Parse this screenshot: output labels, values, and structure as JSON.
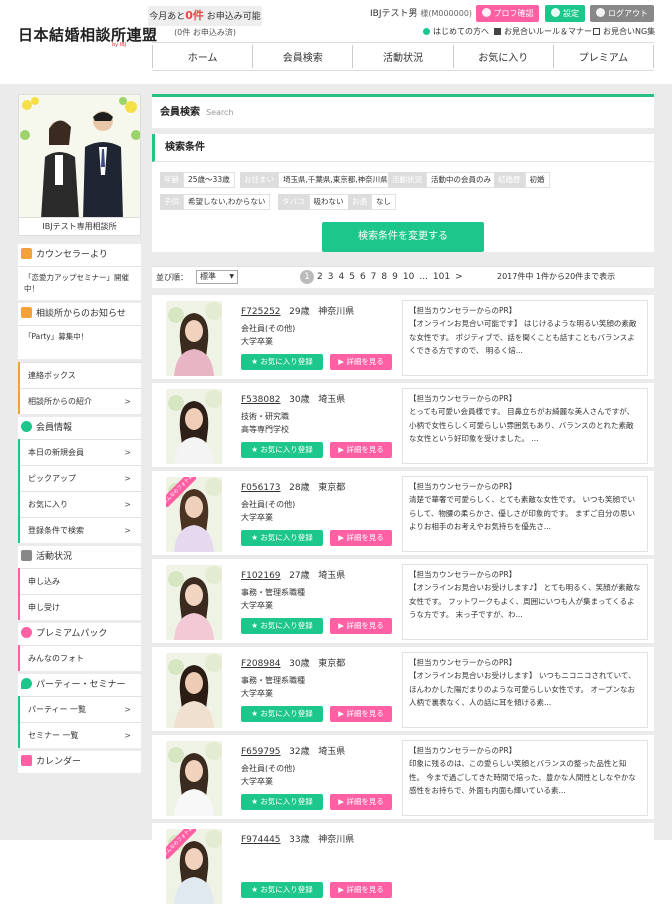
{
  "header": {
    "logo": "日本結婚相談所連盟",
    "logo_sub": "by IBJ",
    "remaining_prefix": "今月あと",
    "remaining_count": "0件",
    "remaining_suffix": " お申込み可能",
    "remaining_sub": "(0件 お申込み済)",
    "user_name": "IBJテスト男",
    "user_id": "様(M000000)",
    "profile_btn": "プロフ確認",
    "settings_btn": "設定",
    "logout_btn": "ログアウト",
    "links": [
      "はじめての方へ",
      "お見合いルール＆マナー",
      "お見合いNG集"
    ]
  },
  "nav": [
    "ホーム",
    "会員検索",
    "活動状況",
    "お気に入り",
    "プレミアム"
  ],
  "sidebar": {
    "shop_name": "IBJテスト専用相談所",
    "counselor_head": "カウンセラーより",
    "counselor_msg": "「恋愛力アップセミナー」開催中！",
    "notice_head": "相談所からのお知らせ",
    "notice_msg": "「Party」募集中！",
    "contact": [
      "連絡ボックス",
      "相談所からの紹介"
    ],
    "member_head": "会員情報",
    "member_items": [
      "本日の新規会員",
      "ピックアップ",
      "お気に入り",
      "登録条件で検索"
    ],
    "activity_head": "活動状況",
    "activity_items": [
      "申し込み",
      "申し受け"
    ],
    "premium_head": "プレミアムパック",
    "premium_items": [
      "みんなのフォト"
    ],
    "party_head": "パーティー・セミナー",
    "party_items": [
      "パーティー 一覧",
      "セミナー 一覧"
    ],
    "calendar_head": "カレンダー"
  },
  "search": {
    "title": "会員検索",
    "title_en": "Search",
    "criteria_head": "検索条件",
    "tags": [
      {
        "k": "年齢",
        "v": "25歳〜33歳"
      },
      {
        "k": "お住まい",
        "v": "埼玉県,千葉県,東京都,神奈川県"
      },
      {
        "k": "活動状況",
        "v": "活動中の会員のみ"
      },
      {
        "k": "結婚歴",
        "v": "初婚"
      },
      {
        "k": "子供",
        "v": "希望しない,わからない"
      },
      {
        "k": "タバコ",
        "v": "吸わない"
      },
      {
        "k": "お酒",
        "v": "なし"
      }
    ],
    "change_btn": "検索条件を変更する",
    "sort_label": "並び順：",
    "sort_value": "標準",
    "pages": [
      "1",
      "2",
      "3",
      "4",
      "5",
      "6",
      "7",
      "8",
      "9",
      "10",
      "...",
      "101",
      ">"
    ],
    "count_text": "2017件中 1件から20件まで表示"
  },
  "fav_label": "お気に入り登録",
  "detail_label": "詳細を見る",
  "pr_head": "【担当カウンセラーからのPR】",
  "ribbon_text": "みんなのフォトあり",
  "members": [
    {
      "id": "F725252",
      "age": "29歳",
      "pref": "神奈川県",
      "job": "会社員(その他)",
      "edu": "大学卒業",
      "ribbon": false,
      "pr": "【オンラインお見合い可能です】 はじけるような明るい笑顔の素敵な女性です。 ポジティブで、話を聞くことも話すこともバランスよくできる方ですので、 明るく焙..."
    },
    {
      "id": "F538082",
      "age": "30歳",
      "pref": "埼玉県",
      "job": "技術・研究職",
      "edu": "高等専門学校",
      "ribbon": false,
      "pr": "とっても可愛い会員様です。 目鼻立ちがお綺麗な美人さんですが、小柄で女性らしく可愛らしい雰囲気もあり、バランスのとれた素敵な女性という好印象を受けました。 ..."
    },
    {
      "id": "F056173",
      "age": "28歳",
      "pref": "東京都",
      "job": "会社員(その他)",
      "edu": "大学卒業",
      "ribbon": true,
      "pr": "清楚で華奢で可愛らしく、とても素敵な女性です。 いつも笑顔でいらして、物腰の柔らかさ、優しさが印象的です。 まずご自分の思いよりお相手のお考えやお気持ちを優先さ..."
    },
    {
      "id": "F102169",
      "age": "27歳",
      "pref": "埼玉県",
      "job": "事務・管理系職種",
      "edu": "大学卒業",
      "ribbon": false,
      "pr": "【オンラインお見合いお受けします♪】 とても明るく、笑顔が素敵な女性です。 フットワークもよく、周囲にいつも人が集まってくるような方です。 末っ子ですが、わ..."
    },
    {
      "id": "F208984",
      "age": "30歳",
      "pref": "東京都",
      "job": "事務・管理系職種",
      "edu": "大学卒業",
      "ribbon": false,
      "pr": "【オンラインお見合いお受けします】 いつもニコニコされていて、ほんわかした陽だまりのような可愛らしい女性です。 オープンなお人柄で裏表なく、人の話に耳を傾ける素..."
    },
    {
      "id": "F659795",
      "age": "32歳",
      "pref": "埼玉県",
      "job": "会社員(その他)",
      "edu": "大学卒業",
      "ribbon": false,
      "pr": "印象に残るのは、この愛らしい笑顔とバランスの整った品性と知性。 今まで過ごしてきた時間で培った、豊かな人間性としなやかな感性をお持ちで、外面も内面も輝いている素..."
    },
    {
      "id": "F974445",
      "age": "33歳",
      "pref": "神奈川県",
      "job": "",
      "edu": "",
      "ribbon": true,
      "pr": ""
    }
  ],
  "colors": {
    "green": "#1dc68a",
    "pink": "#ff5fa3",
    "accent_line": "#27c184"
  }
}
